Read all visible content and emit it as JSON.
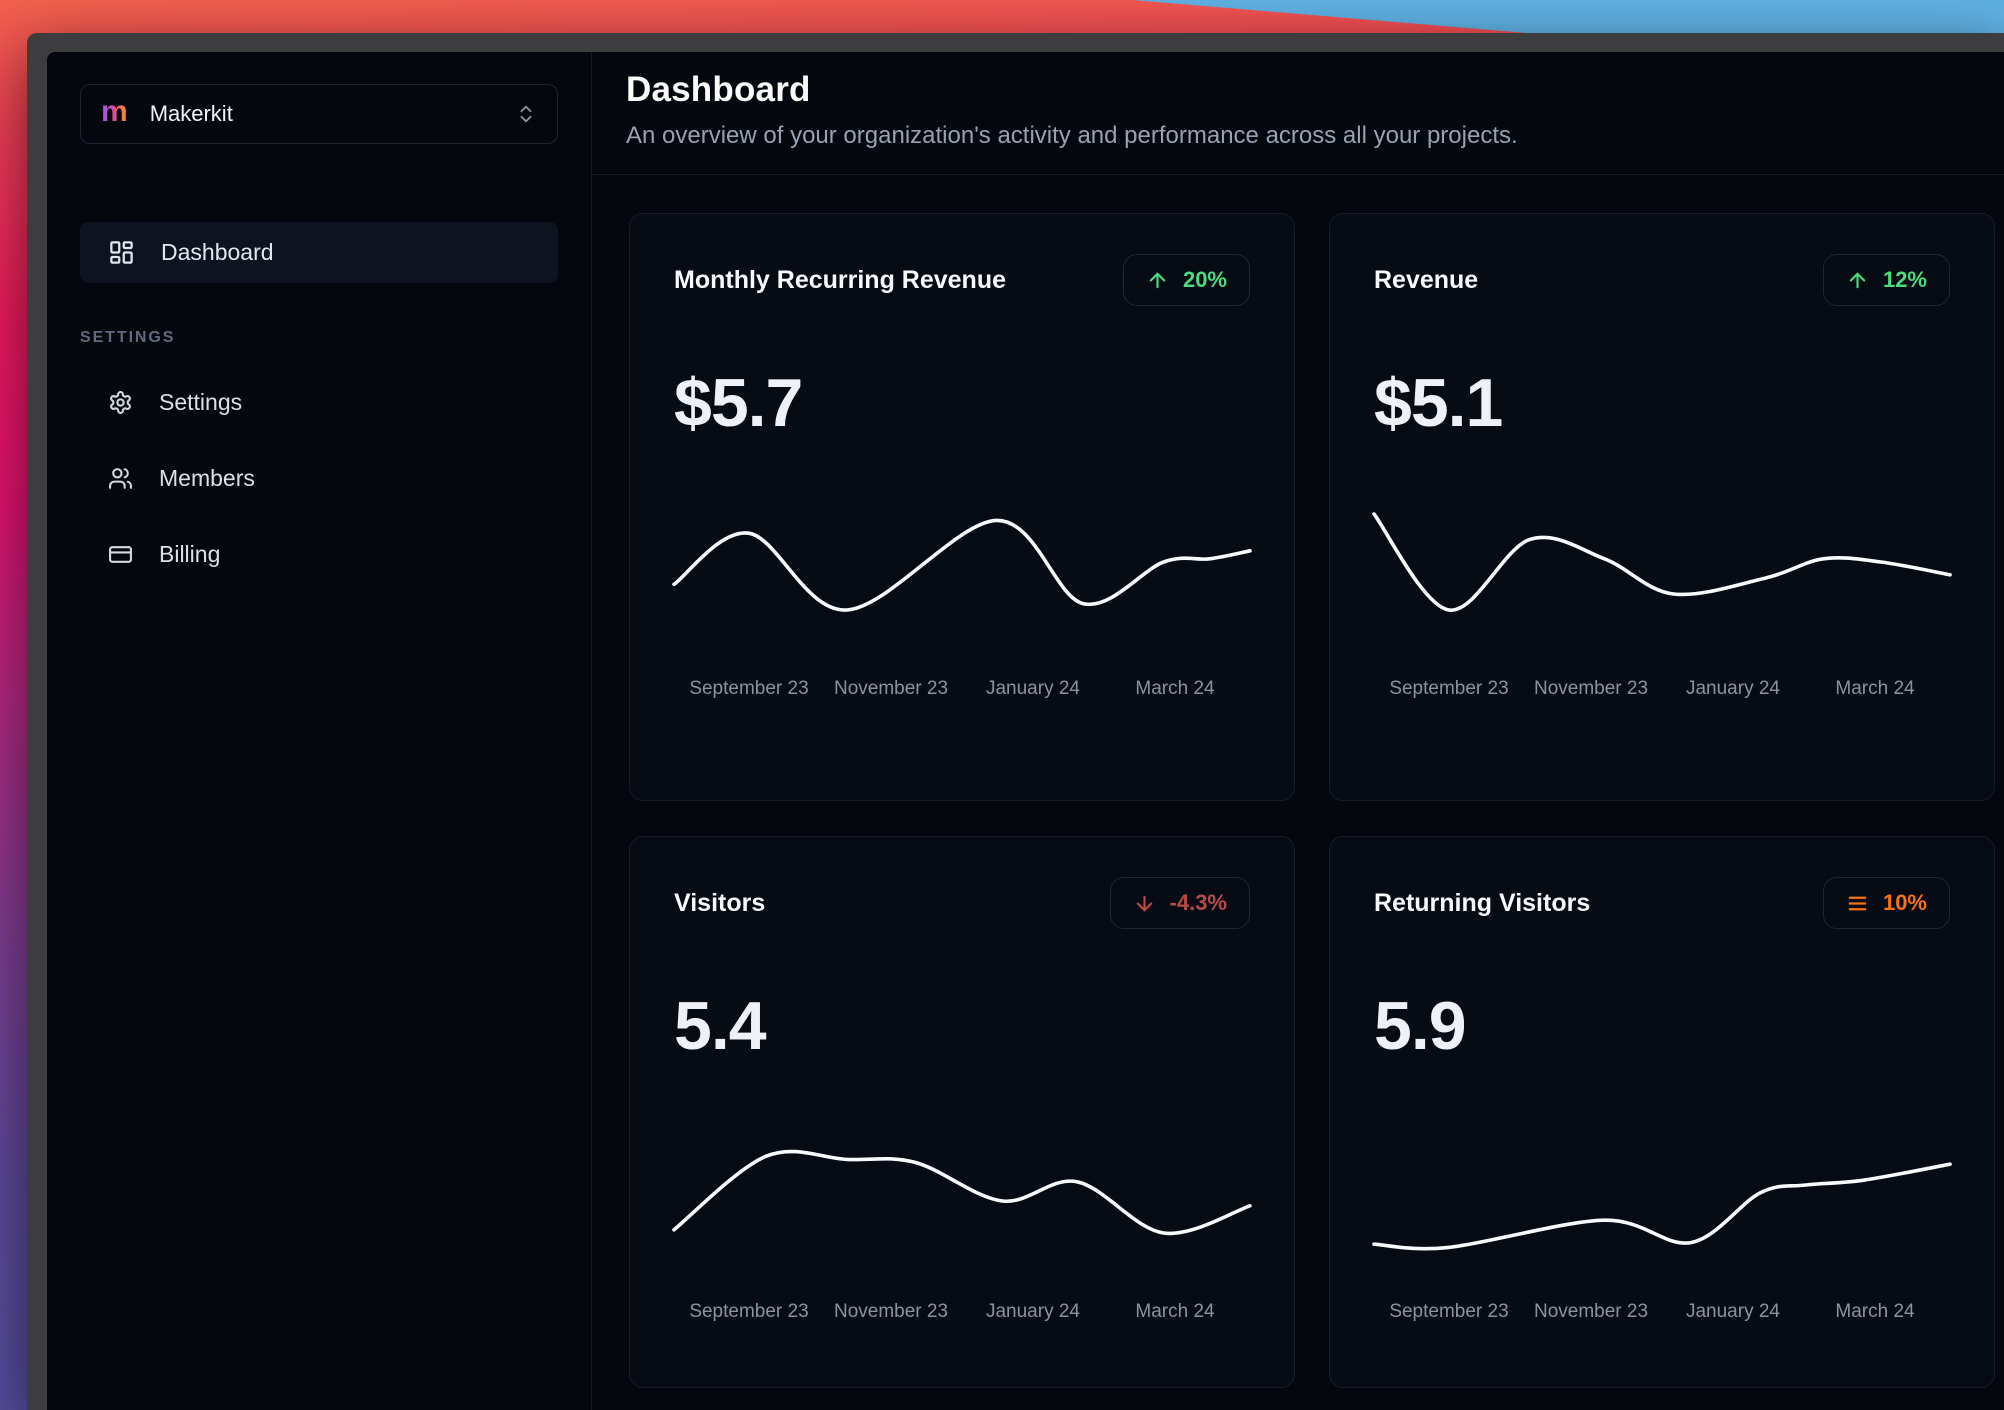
{
  "window": {
    "style": "macos-dark-chrome"
  },
  "sidebar": {
    "workspace": {
      "logo_letter": "m",
      "name": "Makerkit",
      "caret_icon": "chevrons-up-down-icon"
    },
    "nav": [
      {
        "label": "Dashboard",
        "icon": "layout-dashboard-icon",
        "active": true
      }
    ],
    "section_label": "SETTINGS",
    "settings_nav": [
      {
        "label": "Settings",
        "icon": "gear-icon"
      },
      {
        "label": "Members",
        "icon": "users-icon"
      },
      {
        "label": "Billing",
        "icon": "credit-card-icon"
      }
    ]
  },
  "header": {
    "title": "Dashboard",
    "subtitle": "An overview of your organization's activity and performance across all your projects."
  },
  "cards": [
    {
      "title": "Monthly Recurring Revenue",
      "value": "$5.7",
      "trend": "up",
      "trend_value": "20%",
      "trend_icon": "arrow-up-icon"
    },
    {
      "title": "Revenue",
      "value": "$5.1",
      "trend": "up",
      "trend_value": "12%",
      "trend_icon": "arrow-up-icon"
    },
    {
      "title": "Visitors",
      "value": "5.4",
      "trend": "down",
      "trend_value": "-4.3%",
      "trend_icon": "arrow-down-icon"
    },
    {
      "title": "Returning Visitors",
      "value": "5.9",
      "trend": "neutral",
      "trend_value": "10%",
      "trend_icon": "menu-icon"
    }
  ],
  "colors": {
    "trend_up_green": "#4ade80",
    "trend_down_red": "#b94a4a",
    "trend_neutral_orange": "#f97316",
    "chart_line": "#f8fafc",
    "app_background": "#04070d",
    "card_background": "#070b14"
  },
  "chart_data": [
    {
      "type": "line",
      "title": "Monthly Recurring Revenue",
      "headline_value": "$5.7",
      "x_labels": [
        "September 23",
        "November 23",
        "January 24",
        "March 24"
      ],
      "y_axis": "hidden (sparkline, relative units 0-100)",
      "points": [
        [
          0,
          46
        ],
        [
          13,
          78
        ],
        [
          30,
          30
        ],
        [
          56,
          86
        ],
        [
          71,
          34
        ],
        [
          85,
          60
        ],
        [
          93,
          62
        ],
        [
          100,
          67
        ]
      ]
    },
    {
      "type": "line",
      "title": "Revenue",
      "headline_value": "$5.1",
      "x_labels": [
        "September 23",
        "November 23",
        "January 24",
        "March 24"
      ],
      "y_axis": "hidden (sparkline, relative units 0-100)",
      "points": [
        [
          0,
          90
        ],
        [
          13,
          30
        ],
        [
          27,
          74
        ],
        [
          40,
          62
        ],
        [
          52,
          40
        ],
        [
          68,
          50
        ],
        [
          78,
          62
        ],
        [
          88,
          60
        ],
        [
          100,
          52
        ]
      ]
    },
    {
      "type": "line",
      "title": "Visitors",
      "headline_value": "5.4",
      "x_labels": [
        "September 23",
        "November 23",
        "January 24",
        "March 24"
      ],
      "y_axis": "hidden (sparkline, relative units 0-100)",
      "points": [
        [
          0,
          32
        ],
        [
          16,
          78
        ],
        [
          30,
          76
        ],
        [
          42,
          74
        ],
        [
          57,
          50
        ],
        [
          70,
          62
        ],
        [
          85,
          30
        ],
        [
          100,
          47
        ]
      ]
    },
    {
      "type": "line",
      "title": "Returning Visitors",
      "headline_value": "5.9",
      "x_labels": [
        "September 23",
        "November 23",
        "January 24",
        "March 24"
      ],
      "y_axis": "hidden (sparkline, relative units 0-100)",
      "points": [
        [
          0,
          23
        ],
        [
          13,
          21
        ],
        [
          40,
          38
        ],
        [
          55,
          24
        ],
        [
          67,
          55
        ],
        [
          75,
          60
        ],
        [
          85,
          63
        ],
        [
          100,
          73
        ]
      ]
    }
  ]
}
